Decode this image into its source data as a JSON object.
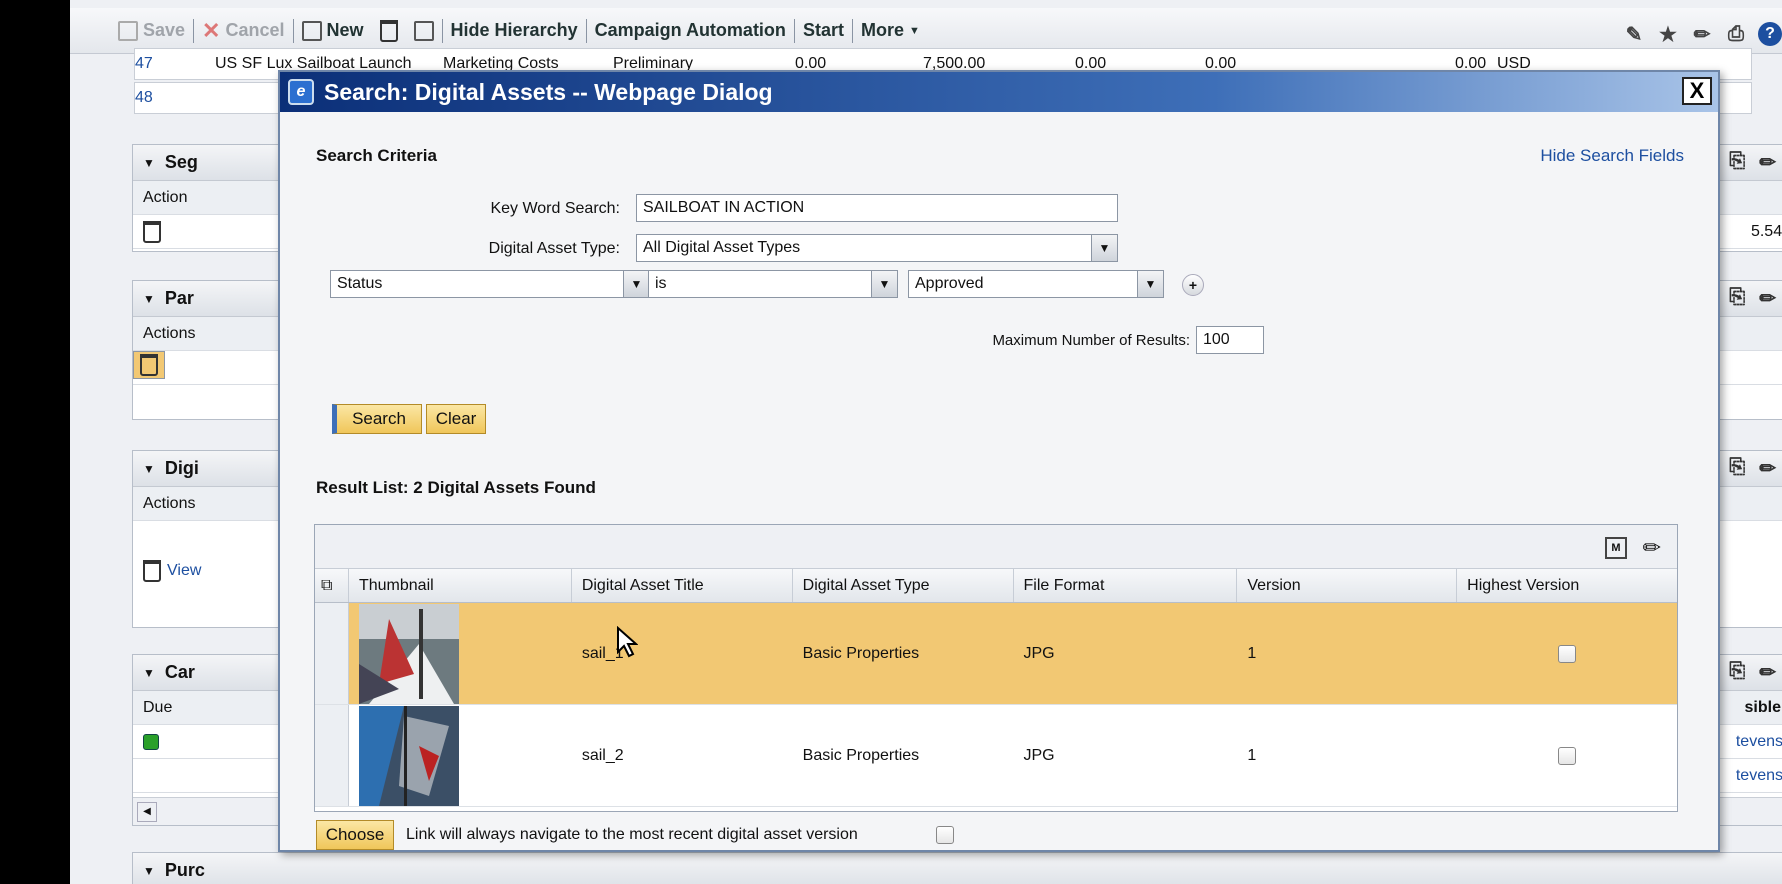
{
  "toolbar": {
    "save": "Save",
    "cancel": "Cancel",
    "new": "New",
    "hide_hierarchy": "Hide Hierarchy",
    "campaign_automation": "Campaign Automation",
    "start": "Start",
    "more": "More"
  },
  "background": {
    "row47": {
      "id": "47",
      "name": "US SF Lux Sailboat Launch",
      "type": "Marketing Costs",
      "status": "Preliminary",
      "v1": "0.00",
      "v2": "7,500.00",
      "v3": "0.00",
      "v4": "0.00",
      "v5": "0.00",
      "currency": "USD"
    },
    "row48": {
      "id": "48"
    },
    "panel1": {
      "title": "Seg",
      "col": "Action",
      "value": "5.540"
    },
    "panel2": {
      "title": "Par",
      "col": "Actions"
    },
    "panel3": {
      "title": "Digi",
      "col": "Actions",
      "view": "View"
    },
    "panel4": {
      "title": "Car",
      "col": "Due",
      "right_col": "sible",
      "r1": "tevens",
      "r2": "tevens"
    },
    "panel5": {
      "title": "Purc"
    }
  },
  "dialog": {
    "title": "Search: Digital Assets -- Webpage Dialog",
    "close": "X",
    "search_criteria": "Search Criteria",
    "hide_search_fields": "Hide Search Fields",
    "keyword_label": "Key Word Search:",
    "keyword_value": "SAILBOAT IN ACTION",
    "asset_type_label": "Digital Asset Type:",
    "asset_type_value": "All Digital Asset Types",
    "filter_field": "Status",
    "filter_op": "is",
    "filter_value": "Approved",
    "max_results_label": "Maximum Number of Results:",
    "max_results_value": "100",
    "search_button": "Search",
    "clear_button": "Clear",
    "result_title": "Result List: 2 Digital Assets Found",
    "columns": [
      "Thumbnail",
      "Digital Asset Title",
      "Digital Asset Type",
      "File Format",
      "Version",
      "Highest Version"
    ],
    "rows": [
      {
        "title": "sail_1",
        "type": "Basic Properties",
        "format": "JPG",
        "version": "1"
      },
      {
        "title": "sail_2",
        "type": "Basic Properties",
        "format": "JPG",
        "version": "1"
      }
    ],
    "choose_button": "Choose",
    "link_note": "Link will always navigate to the most recent digital asset version"
  },
  "colors": {
    "highlight": "#f2c873",
    "title_bar": "#0b2f78"
  }
}
